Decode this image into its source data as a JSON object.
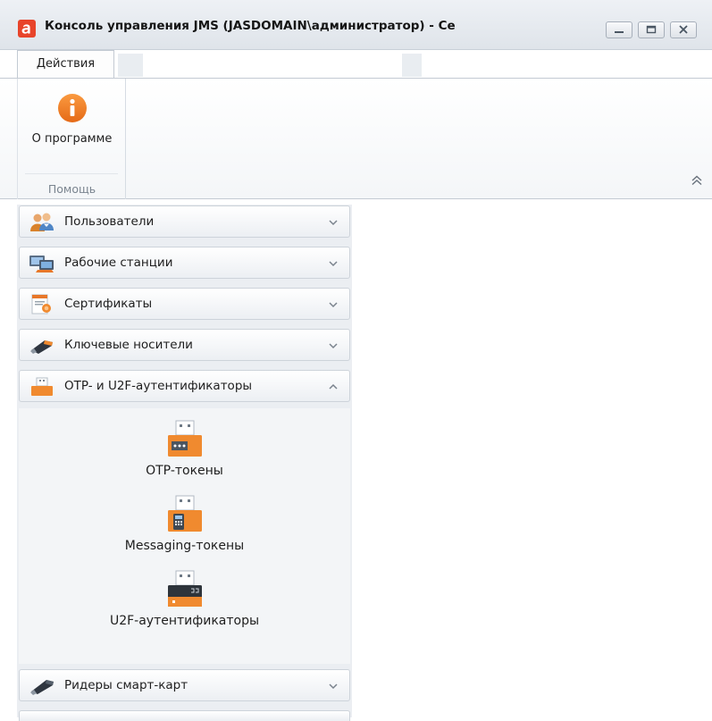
{
  "window": {
    "title": "Консоль управления JMS (JASDOMAIN\\администратор) - Сервер: J...",
    "logo_letter": "a",
    "brand_color": "#e8442a"
  },
  "ribbon": {
    "tabs": [
      {
        "label": "Действия",
        "active": true
      }
    ],
    "groups": [
      {
        "label": "Помощь",
        "buttons": [
          {
            "label": "О программе",
            "icon": "info-icon"
          }
        ]
      }
    ]
  },
  "nav": {
    "sections": [
      {
        "label": "Пользователи",
        "icon": "users-icon",
        "expanded": false
      },
      {
        "label": "Рабочие станции",
        "icon": "workstations-icon",
        "expanded": false
      },
      {
        "label": "Сертификаты",
        "icon": "certificates-icon",
        "expanded": false
      },
      {
        "label": "Ключевые носители",
        "icon": "key-media-icon",
        "expanded": false
      },
      {
        "label": "OTP- и U2F-аутентификаторы",
        "icon": "otp-u2f-icon",
        "expanded": true
      },
      {
        "label": "Ридеры смарт-карт",
        "icon": "smartcard-reader-icon",
        "expanded": false
      }
    ],
    "expanded_items": [
      {
        "label": "OTP-токены",
        "icon": "otp-token-icon"
      },
      {
        "label": "Messaging-токены",
        "icon": "messaging-token-icon"
      },
      {
        "label": "U2F-аутентификаторы",
        "icon": "u2f-token-icon"
      }
    ]
  },
  "colors": {
    "accent": "#f07f2a",
    "panel_bg": "#ebeef2",
    "ribbon_border": "#c3cad3"
  }
}
